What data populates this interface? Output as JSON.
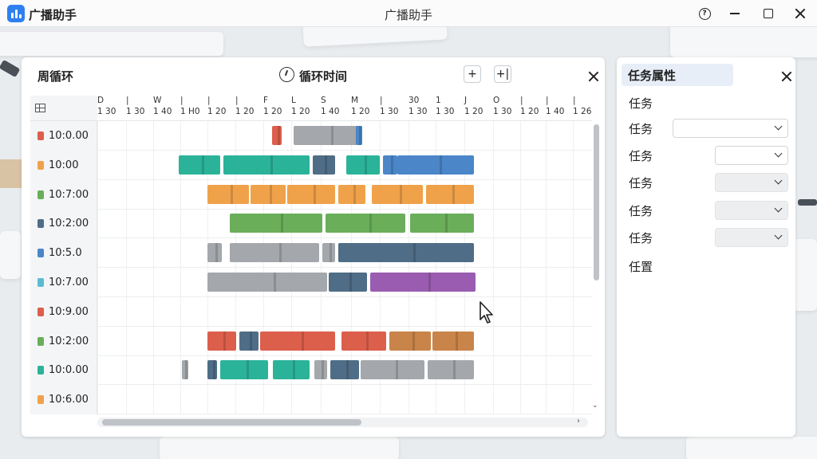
{
  "app": {
    "name": "广播助手",
    "window_title": "广播助手"
  },
  "colors": {
    "accent": "#2f7ff0",
    "gray": "#a4a7ab",
    "teal": "#2bb39a",
    "blue": "#4a86c8",
    "orange": "#efa24a",
    "green": "#6aae5a",
    "slate": "#4f6d86",
    "purple": "#9a5cb0",
    "red": "#dc5f4c",
    "brown": "#c9844a",
    "cyan": "#5bbcd0"
  },
  "panel": {
    "title": "周循环",
    "cycle_label": "循环时间",
    "add_button": "+",
    "add_multi_button": "+|"
  },
  "axis": [
    {
      "top": "D",
      "bot": "1 30"
    },
    {
      "top": "",
      "bot": "1 30"
    },
    {
      "top": "W",
      "bot": "1 40"
    },
    {
      "top": "",
      "bot": "1 H0"
    },
    {
      "top": "",
      "bot": "1 20"
    },
    {
      "top": "",
      "bot": "1 20"
    },
    {
      "top": "F",
      "bot": "1 20"
    },
    {
      "top": "L",
      "bot": "1 20"
    },
    {
      "top": "S",
      "bot": "1 40"
    },
    {
      "top": "M",
      "bot": "1 20"
    },
    {
      "top": "",
      "bot": "1 30"
    },
    {
      "top": "30",
      "bot": "1 30"
    },
    {
      "top": "1",
      "bot": "1 30"
    },
    {
      "top": "J",
      "bot": "1 20"
    },
    {
      "top": "O",
      "bot": "1 30"
    },
    {
      "top": "",
      "bot": "1 20"
    },
    {
      "top": "",
      "bot": "1 40"
    },
    {
      "top": "",
      "bot": "1 26"
    }
  ],
  "rows": [
    {
      "time": "10:0.00",
      "color": "#dc5f4c"
    },
    {
      "time": "10:00",
      "color": "#efa24a"
    },
    {
      "time": "10:7:00",
      "color": "#6aae5a"
    },
    {
      "time": "10:2:00",
      "color": "#4f6d86"
    },
    {
      "time": "10:5.0",
      "color": "#4a86c8"
    },
    {
      "time": "10:7.00",
      "color": "#5bbcd0"
    },
    {
      "time": "10:9.00",
      "color": "#dc5f4c"
    },
    {
      "time": "10:2:00",
      "color": "#6aae5a"
    },
    {
      "time": "10:0.00",
      "color": "#2bb39a"
    },
    {
      "time": "10:6.00",
      "color": "#efa24a"
    }
  ],
  "properties": {
    "title": "任务属性",
    "rows": [
      {
        "label": "任务",
        "has_select": false,
        "filled": false
      },
      {
        "label": "任务",
        "has_select": true,
        "filled": false
      },
      {
        "label": "任务",
        "has_select": true,
        "filled": false
      },
      {
        "label": "任务",
        "has_select": true,
        "filled": true
      },
      {
        "label": "任务",
        "has_select": true,
        "filled": true
      },
      {
        "label": "任务",
        "has_select": true,
        "filled": true
      },
      {
        "label": "任置",
        "has_select": false,
        "filled": false
      }
    ]
  }
}
